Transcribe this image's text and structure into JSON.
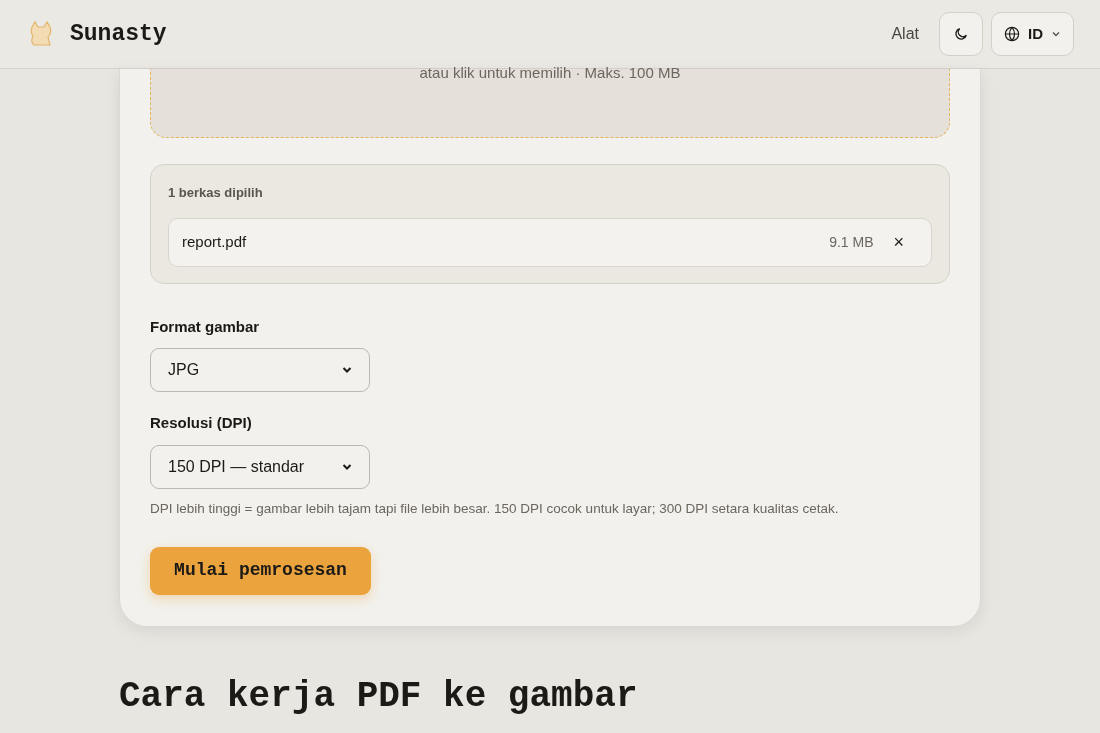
{
  "header": {
    "brand": "Sunasty",
    "nav_link": "Alat",
    "language": "ID"
  },
  "dropzone": {
    "hint": "atau klik untuk memilih · Maks. 100 MB"
  },
  "selected_files": {
    "title": "1 berkas dipilih",
    "files": [
      {
        "name": "report.pdf",
        "size": "9.1 MB",
        "remove": "×"
      }
    ]
  },
  "fields": [
    {
      "label": "Format gambar",
      "value": "JPG"
    },
    {
      "label": "Resolusi (DPI)",
      "value": "150 DPI — standar",
      "help": "DPI lebih tinggi = gambar lebih tajam tapi file lebih besar. 150 DPI cocok untuk layar; 300 DPI setara kualitas cetak."
    }
  ],
  "start_button": "Mulai pemrosesan",
  "section_heading": "Cara kerja PDF ke gambar"
}
